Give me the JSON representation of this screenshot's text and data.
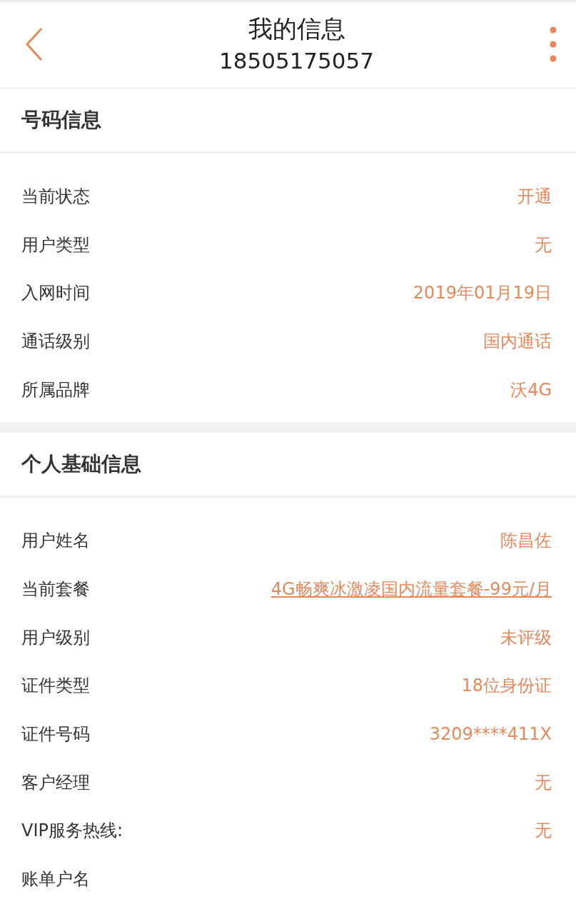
{
  "header": {
    "title": "我的信息",
    "subtitle": "18505175057"
  },
  "sections": [
    {
      "title": "号码信息",
      "rows": [
        {
          "label": "当前状态",
          "value": "开通",
          "kind": "text"
        },
        {
          "label": "用户类型",
          "value": "无",
          "kind": "text"
        },
        {
          "label": "入网时间",
          "value": "2019年01月19日",
          "kind": "text"
        },
        {
          "label": "通话级别",
          "value": "国内通话",
          "kind": "text"
        },
        {
          "label": "所属品牌",
          "value": "沃4G",
          "kind": "text"
        }
      ]
    },
    {
      "title": "个人基础信息",
      "rows": [
        {
          "label": "用户姓名",
          "value": "陈昌佐",
          "kind": "text"
        },
        {
          "label": "当前套餐",
          "value": "4G畅爽冰激凌国内流量套餐-99元/月",
          "kind": "link"
        },
        {
          "label": "用户级别",
          "value": "未评级",
          "kind": "text"
        },
        {
          "label": "证件类型",
          "value": "18位身份证",
          "kind": "text"
        },
        {
          "label": "证件号码",
          "value": "3209****411X",
          "kind": "text"
        },
        {
          "label": "客户经理",
          "value": "无",
          "kind": "text"
        },
        {
          "label": "VIP服务热线:",
          "value": "无",
          "kind": "text"
        },
        {
          "label": "账单户名",
          "kind": "text"
        }
      ]
    }
  ]
}
